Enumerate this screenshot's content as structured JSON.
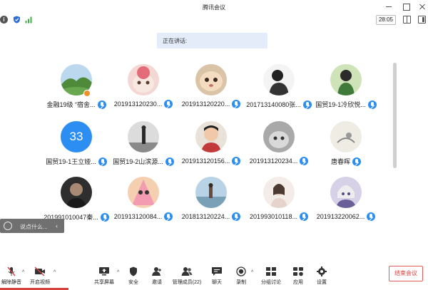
{
  "window": {
    "title": "腾讯会议"
  },
  "status": {
    "timer": "28:05"
  },
  "speaking": {
    "label": "正在讲话:"
  },
  "participants": [
    {
      "name": "金融19级 “宿舍..."
    },
    {
      "name": "201913120230..."
    },
    {
      "name": "201913120220..."
    },
    {
      "name": "201713140080张..."
    },
    {
      "name": "国贸19-1冷欣悦..."
    },
    {
      "name": "国贸19-1王立娅..."
    },
    {
      "name": "国贸19-2山滨源..."
    },
    {
      "name": "201913120156..."
    },
    {
      "name": "201913120234..."
    },
    {
      "name": "唐春晖"
    },
    {
      "name": "201991010047秦..."
    },
    {
      "name": "201913120084..."
    },
    {
      "name": "201813120224..."
    },
    {
      "name": "201993010118..."
    },
    {
      "name": "201913220062..."
    }
  ],
  "avatar_number": "33",
  "chat": {
    "placeholder": "说点什么..."
  },
  "toolbar": {
    "mute": "解除静音",
    "video": "开启视频",
    "share": "共享屏幕",
    "security": "安全",
    "invite": "邀请",
    "members": "管理成员(22)",
    "chat": "聊天",
    "record": "录制",
    "breakout": "分组讨论",
    "apps": "应用",
    "settings": "设置",
    "end": "结束会议"
  },
  "colors": {
    "accent": "#2c8ef2",
    "end_red": "#e03b3b",
    "banner_bg": "#e3ecf8"
  }
}
